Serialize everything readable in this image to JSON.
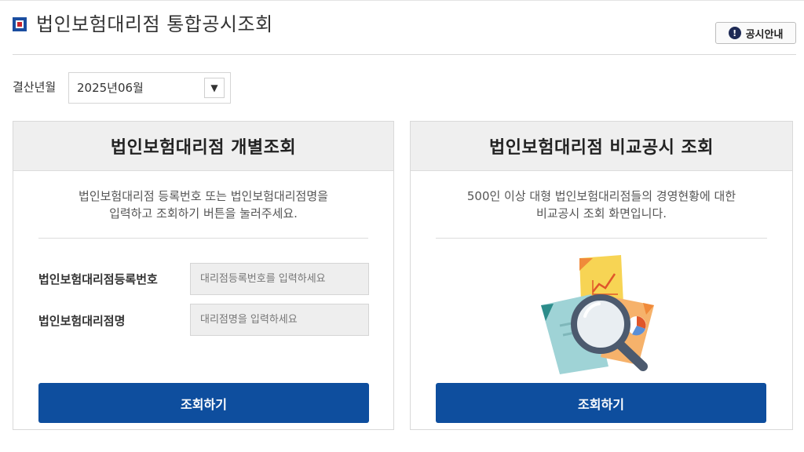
{
  "header": {
    "title": "법인보험대리점 통합공시조회",
    "notice_button": "공시안내",
    "notice_icon": "!"
  },
  "settlement": {
    "label": "결산년월",
    "selected": "2025년06월",
    "arrow": "▼"
  },
  "individual": {
    "title": "법인보험대리점 개별조회",
    "desc_line1": "법인보험대리점 등록번호 또는 법인보험대리점명을",
    "desc_line2": "입력하고 조회하기 버튼을 눌러주세요.",
    "reg_label": "법인보험대리점등록번호",
    "reg_placeholder": "대리점등록번호를 입력하세요",
    "name_label": "법인보험대리점명",
    "name_placeholder": "대리점명을 입력하세요",
    "button": "조회하기"
  },
  "comparison": {
    "title": "법인보험대리점 비교공시 조회",
    "desc_line1": "500인 이상 대형 법인보험대리점들의 경영현황에 대한",
    "desc_line2": "비교공시 조회 화면입니다.",
    "button": "조회하기",
    "illustration": "magnifier-documents-icon"
  },
  "colors": {
    "primary": "#0e4e9e",
    "title_mark_blue": "#1b4ea0",
    "title_mark_red": "#c9252c"
  }
}
